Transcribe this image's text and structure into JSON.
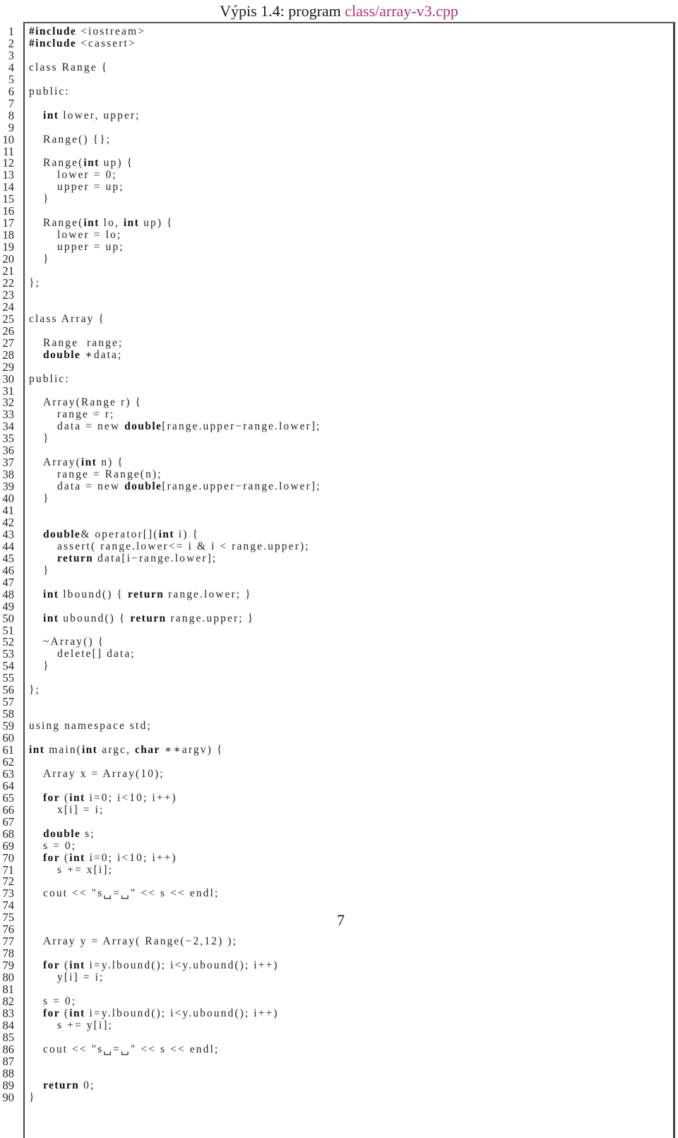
{
  "listing": {
    "caption_prefix": "Výpis 1.4: program ",
    "caption_file": "class/array-v3.cpp",
    "accent_color": "#b0307a",
    "page_number": "7",
    "lines": [
      {
        "n": "1",
        "indent": 0,
        "parts": [
          {
            "b": "#include"
          },
          {
            "t": " <iostream>"
          }
        ]
      },
      {
        "n": "2",
        "indent": 0,
        "parts": [
          {
            "b": "#include"
          },
          {
            "t": " <cassert>"
          }
        ]
      },
      {
        "n": "3",
        "indent": 0,
        "parts": []
      },
      {
        "n": "4",
        "indent": 0,
        "parts": [
          {
            "t": "class Range {"
          }
        ]
      },
      {
        "n": "5",
        "indent": 0,
        "parts": []
      },
      {
        "n": "6",
        "indent": 0,
        "parts": [
          {
            "t": "public:"
          }
        ]
      },
      {
        "n": "7",
        "indent": 0,
        "parts": []
      },
      {
        "n": "8",
        "indent": 1,
        "parts": [
          {
            "b": "int"
          },
          {
            "t": " lower, upper;"
          }
        ]
      },
      {
        "n": "9",
        "indent": 0,
        "parts": []
      },
      {
        "n": "10",
        "indent": 1,
        "parts": [
          {
            "t": "Range() {};"
          }
        ]
      },
      {
        "n": "11",
        "indent": 0,
        "parts": []
      },
      {
        "n": "12",
        "indent": 1,
        "parts": [
          {
            "t": "Range("
          },
          {
            "b": "int"
          },
          {
            "t": " up) {"
          }
        ]
      },
      {
        "n": "13",
        "indent": 2,
        "parts": [
          {
            "t": "lower = 0;"
          }
        ]
      },
      {
        "n": "14",
        "indent": 2,
        "parts": [
          {
            "t": "upper = up;"
          }
        ]
      },
      {
        "n": "15",
        "indent": 1,
        "parts": [
          {
            "t": "}"
          }
        ]
      },
      {
        "n": "16",
        "indent": 0,
        "parts": []
      },
      {
        "n": "17",
        "indent": 1,
        "parts": [
          {
            "t": "Range("
          },
          {
            "b": "int"
          },
          {
            "t": " lo, "
          },
          {
            "b": "int"
          },
          {
            "t": " up) {"
          }
        ]
      },
      {
        "n": "18",
        "indent": 2,
        "parts": [
          {
            "t": "lower = lo;"
          }
        ]
      },
      {
        "n": "19",
        "indent": 2,
        "parts": [
          {
            "t": "upper = up;"
          }
        ]
      },
      {
        "n": "20",
        "indent": 1,
        "parts": [
          {
            "t": "}"
          }
        ]
      },
      {
        "n": "21",
        "indent": 0,
        "parts": []
      },
      {
        "n": "22",
        "indent": 0,
        "parts": [
          {
            "t": "};"
          }
        ]
      },
      {
        "n": "23",
        "indent": 0,
        "parts": []
      },
      {
        "n": "24",
        "indent": 0,
        "parts": []
      },
      {
        "n": "25",
        "indent": 0,
        "parts": [
          {
            "t": "class Array {"
          }
        ]
      },
      {
        "n": "26",
        "indent": 0,
        "parts": []
      },
      {
        "n": "27",
        "indent": 1,
        "parts": [
          {
            "t": "Range  range;"
          }
        ]
      },
      {
        "n": "28",
        "indent": 1,
        "parts": [
          {
            "b": "double"
          },
          {
            "t": " ∗data;"
          }
        ]
      },
      {
        "n": "29",
        "indent": 0,
        "parts": []
      },
      {
        "n": "30",
        "indent": 0,
        "parts": [
          {
            "t": "public:"
          }
        ]
      },
      {
        "n": "31",
        "indent": 0,
        "parts": []
      },
      {
        "n": "32",
        "indent": 1,
        "parts": [
          {
            "t": "Array(Range r) {"
          }
        ]
      },
      {
        "n": "33",
        "indent": 2,
        "parts": [
          {
            "t": "range = r;"
          }
        ]
      },
      {
        "n": "34",
        "indent": 2,
        "parts": [
          {
            "t": "data = new "
          },
          {
            "b": "double"
          },
          {
            "t": "[range.upper−range.lower];"
          }
        ]
      },
      {
        "n": "35",
        "indent": 1,
        "parts": [
          {
            "t": "}"
          }
        ]
      },
      {
        "n": "36",
        "indent": 0,
        "parts": []
      },
      {
        "n": "37",
        "indent": 1,
        "parts": [
          {
            "t": "Array("
          },
          {
            "b": "int"
          },
          {
            "t": " n) {"
          }
        ]
      },
      {
        "n": "38",
        "indent": 2,
        "parts": [
          {
            "t": "range = Range(n);"
          }
        ]
      },
      {
        "n": "39",
        "indent": 2,
        "parts": [
          {
            "t": "data = new "
          },
          {
            "b": "double"
          },
          {
            "t": "[range.upper−range.lower];"
          }
        ]
      },
      {
        "n": "40",
        "indent": 1,
        "parts": [
          {
            "t": "}"
          }
        ]
      },
      {
        "n": "41",
        "indent": 0,
        "parts": []
      },
      {
        "n": "42",
        "indent": 0,
        "parts": []
      },
      {
        "n": "43",
        "indent": 1,
        "parts": [
          {
            "b": "double"
          },
          {
            "t": "& operator[]("
          },
          {
            "b": "int"
          },
          {
            "t": " i) {"
          }
        ]
      },
      {
        "n": "44",
        "indent": 2,
        "parts": [
          {
            "t": "assert( range.lower<= i & i < range.upper);"
          }
        ]
      },
      {
        "n": "45",
        "indent": 2,
        "parts": [
          {
            "b": "return"
          },
          {
            "t": " data[i−range.lower];"
          }
        ]
      },
      {
        "n": "46",
        "indent": 1,
        "parts": [
          {
            "t": "}"
          }
        ]
      },
      {
        "n": "47",
        "indent": 0,
        "parts": []
      },
      {
        "n": "48",
        "indent": 1,
        "parts": [
          {
            "b": "int"
          },
          {
            "t": " lbound() { "
          },
          {
            "b": "return"
          },
          {
            "t": " range.lower; }"
          }
        ]
      },
      {
        "n": "49",
        "indent": 0,
        "parts": []
      },
      {
        "n": "50",
        "indent": 1,
        "parts": [
          {
            "b": "int"
          },
          {
            "t": " ubound() { "
          },
          {
            "b": "return"
          },
          {
            "t": " range.upper; }"
          }
        ]
      },
      {
        "n": "51",
        "indent": 0,
        "parts": []
      },
      {
        "n": "52",
        "indent": 1,
        "parts": [
          {
            "t": "~Array() {"
          }
        ]
      },
      {
        "n": "53",
        "indent": 2,
        "parts": [
          {
            "t": "delete[] data;"
          }
        ]
      },
      {
        "n": "54",
        "indent": 1,
        "parts": [
          {
            "t": "}"
          }
        ]
      },
      {
        "n": "55",
        "indent": 0,
        "parts": []
      },
      {
        "n": "56",
        "indent": 0,
        "parts": [
          {
            "t": "};"
          }
        ]
      },
      {
        "n": "57",
        "indent": 0,
        "parts": []
      },
      {
        "n": "58",
        "indent": 0,
        "parts": []
      },
      {
        "n": "59",
        "indent": 0,
        "parts": [
          {
            "t": "using namespace std;"
          }
        ]
      },
      {
        "n": "60",
        "indent": 0,
        "parts": []
      },
      {
        "n": "61",
        "indent": 0,
        "parts": [
          {
            "b": "int"
          },
          {
            "t": " main("
          },
          {
            "b": "int"
          },
          {
            "t": " argc, "
          },
          {
            "b": "char"
          },
          {
            "t": " ∗∗argv) {"
          }
        ]
      },
      {
        "n": "62",
        "indent": 0,
        "parts": []
      },
      {
        "n": "63",
        "indent": 1,
        "parts": [
          {
            "t": "Array x = Array(10);"
          }
        ]
      },
      {
        "n": "64",
        "indent": 0,
        "parts": []
      },
      {
        "n": "65",
        "indent": 1,
        "parts": [
          {
            "b": "for"
          },
          {
            "t": " ("
          },
          {
            "b": "int"
          },
          {
            "t": " i=0; i<10; i++)"
          }
        ]
      },
      {
        "n": "66",
        "indent": 2,
        "parts": [
          {
            "t": "x[i] = i;"
          }
        ]
      },
      {
        "n": "67",
        "indent": 0,
        "parts": []
      },
      {
        "n": "68",
        "indent": 1,
        "parts": [
          {
            "b": "double"
          },
          {
            "t": " s;"
          }
        ]
      },
      {
        "n": "69",
        "indent": 1,
        "parts": [
          {
            "t": "s = 0;"
          }
        ]
      },
      {
        "n": "70",
        "indent": 1,
        "parts": [
          {
            "b": "for"
          },
          {
            "t": " ("
          },
          {
            "b": "int"
          },
          {
            "t": " i=0; i<10; i++)"
          }
        ]
      },
      {
        "n": "71",
        "indent": 2,
        "parts": [
          {
            "t": "s += x[i];"
          }
        ]
      },
      {
        "n": "72",
        "indent": 0,
        "parts": []
      },
      {
        "n": "73",
        "indent": 1,
        "parts": [
          {
            "t": "cout << \"s␣=␣\" << s << endl;"
          }
        ]
      },
      {
        "n": "74",
        "indent": 0,
        "parts": []
      },
      {
        "n": "75",
        "indent": 0,
        "parts": []
      },
      {
        "n": "76",
        "indent": 0,
        "parts": []
      },
      {
        "n": "77",
        "indent": 1,
        "parts": [
          {
            "t": "Array y = Array( Range(−2,12) );"
          }
        ]
      },
      {
        "n": "78",
        "indent": 0,
        "parts": []
      },
      {
        "n": "79",
        "indent": 1,
        "parts": [
          {
            "b": "for"
          },
          {
            "t": " ("
          },
          {
            "b": "int"
          },
          {
            "t": " i=y.lbound(); i<y.ubound(); i++)"
          }
        ]
      },
      {
        "n": "80",
        "indent": 2,
        "parts": [
          {
            "t": "y[i] = i;"
          }
        ]
      },
      {
        "n": "81",
        "indent": 0,
        "parts": []
      },
      {
        "n": "82",
        "indent": 1,
        "parts": [
          {
            "t": "s = 0;"
          }
        ]
      },
      {
        "n": "83",
        "indent": 1,
        "parts": [
          {
            "b": "for"
          },
          {
            "t": " ("
          },
          {
            "b": "int"
          },
          {
            "t": " i=y.lbound(); i<y.ubound(); i++)"
          }
        ]
      },
      {
        "n": "84",
        "indent": 2,
        "parts": [
          {
            "t": "s += y[i];"
          }
        ]
      },
      {
        "n": "85",
        "indent": 0,
        "parts": []
      },
      {
        "n": "86",
        "indent": 1,
        "parts": [
          {
            "t": "cout << \"s␣=␣\" << s << endl;"
          }
        ]
      },
      {
        "n": "87",
        "indent": 0,
        "parts": []
      },
      {
        "n": "88",
        "indent": 0,
        "parts": []
      },
      {
        "n": "89",
        "indent": 1,
        "parts": [
          {
            "b": "return"
          },
          {
            "t": " 0;"
          }
        ]
      },
      {
        "n": "90",
        "indent": 0,
        "parts": [
          {
            "t": "}"
          }
        ]
      }
    ]
  }
}
